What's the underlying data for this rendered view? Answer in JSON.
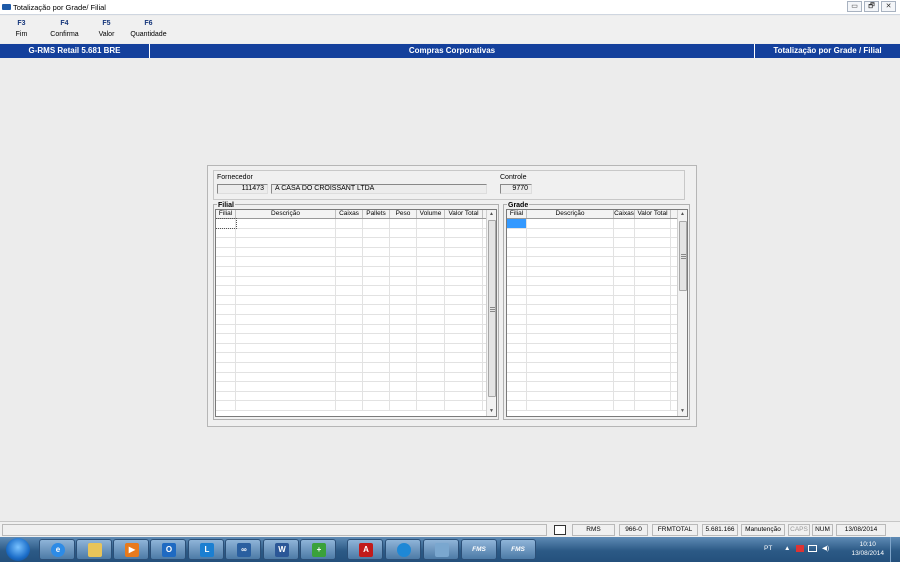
{
  "window": {
    "title": "Totalização por Grade/ Filial",
    "controls": [
      "▭",
      "🗗",
      "✕"
    ]
  },
  "fkeys": [
    {
      "key": "F3",
      "label": "Fim"
    },
    {
      "key": "F4",
      "label": "Confirma"
    },
    {
      "key": "F5",
      "label": "Valor"
    },
    {
      "key": "F6",
      "label": "Quantidade"
    }
  ],
  "banner": {
    "left": "G-RMS Retail 5.681 BRE",
    "center": "Compras Corporativas",
    "right": "Totalização por Grade / Filial"
  },
  "form": {
    "fornecedor_label": "Fornecedor",
    "fornecedor_code": "111473",
    "fornecedor_name": "A CASA DO CROISSANT LTDA",
    "controle_label": "Controle",
    "controle_value": "9770"
  },
  "filial": {
    "title": "Filial",
    "columns": [
      "Filial",
      "Descrição",
      "Caixas",
      "Pallets",
      "Peso",
      "Volume",
      "Valor Total"
    ]
  },
  "grade": {
    "title": "Grade",
    "columns": [
      "Filial",
      "Descrição",
      "Caixas",
      "Valor Total"
    ]
  },
  "statusbar": {
    "items": [
      "RMS",
      "966-0",
      "FRMTOTAL",
      "5.681.166",
      "Manutenção",
      "CAPS",
      "NUM",
      "13/08/2014"
    ]
  },
  "taskbar": {
    "fms1": "FMS",
    "fms2": "FMS",
    "tray_lang": "PT",
    "time": "10:10",
    "date": "13/08/2014"
  },
  "colors": {
    "banner": "#14409c",
    "fkey": "#14357a",
    "selected_cell": "#3399ff"
  }
}
